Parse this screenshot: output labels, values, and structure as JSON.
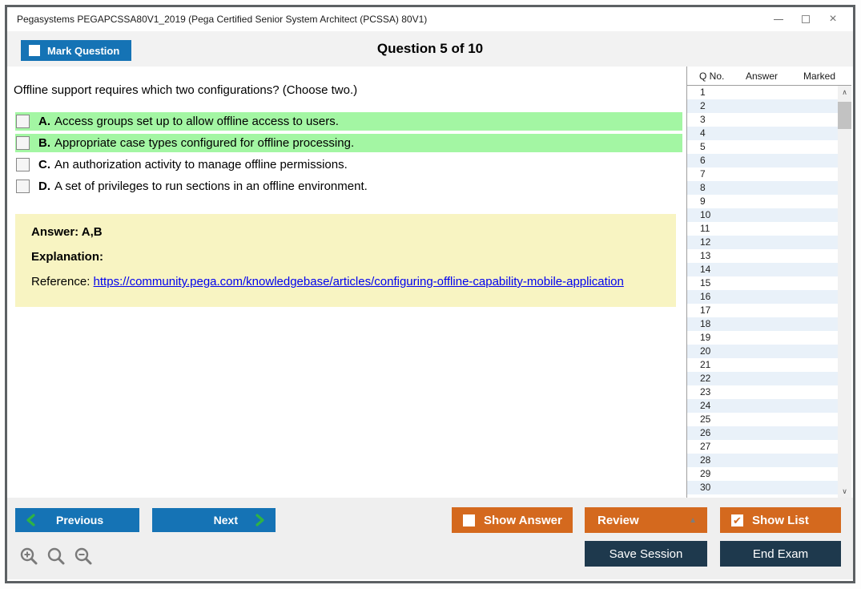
{
  "window": {
    "title": "Pegasystems PEGAPCSSA80V1_2019 (Pega Certified Senior System Architect (PCSSA) 80V1)"
  },
  "header": {
    "mark_question": "Mark Question",
    "mark_checkbox_checked": false,
    "question_counter": "Question 5 of 10"
  },
  "question": {
    "text": "Offline support requires which two configurations? (Choose two.)",
    "options": [
      {
        "letter": "A.",
        "text": "Access groups set up to allow offline access to users.",
        "highlighted": true,
        "checked": false
      },
      {
        "letter": "B.",
        "text": "Appropriate case types configured for offline processing.",
        "highlighted": true,
        "checked": false
      },
      {
        "letter": "C.",
        "text": "An authorization activity to manage offline permissions.",
        "highlighted": false,
        "checked": false
      },
      {
        "letter": "D.",
        "text": "A set of privileges to run sections in an offline environment.",
        "highlighted": false,
        "checked": false
      }
    ]
  },
  "answer_panel": {
    "answer": "Answer: A,B",
    "explanation": "Explanation:",
    "reference_label": "Reference:",
    "reference_url": "https://community.pega.com/knowledgebase/articles/configuring-offline-capability-mobile-application"
  },
  "question_list": {
    "columns": [
      "Q No.",
      "Answer",
      "Marked"
    ],
    "visible_rows": [
      1,
      2,
      3,
      4,
      5,
      6,
      7,
      8,
      9,
      10,
      11,
      12,
      13,
      14,
      15,
      16,
      17,
      18,
      19,
      20,
      21,
      22,
      23,
      24,
      25,
      26,
      27,
      28,
      29,
      30
    ]
  },
  "footer": {
    "previous": "Previous",
    "next": "Next",
    "show_answer": "Show Answer",
    "show_answer_checked": false,
    "review": "Review",
    "show_list": "Show List",
    "show_list_checked": true,
    "save_session": "Save Session",
    "end_exam": "End Exam"
  },
  "icons": {
    "minimize": "–",
    "maximize": "square",
    "close": "×",
    "scroll_up": "∧",
    "scroll_down": "∨",
    "review_dropdown": "▲",
    "show_list_check": "✔",
    "previous_chevron": "chevron-left",
    "next_chevron": "chevron-right",
    "zoom_in": "magnifier-plus",
    "zoom_default": "magnifier",
    "zoom_out": "magnifier-minus"
  },
  "colors": {
    "accent_blue": "#1573b5",
    "accent_orange": "#d4691e",
    "dark_navy": "#1e394d",
    "option_green": "#a3f6a3",
    "panel_yellow": "#f8f4c2",
    "stripe_blue": "#e9f1f9",
    "chevron_green": "#2fb344",
    "link_blue": "#0000ee"
  }
}
